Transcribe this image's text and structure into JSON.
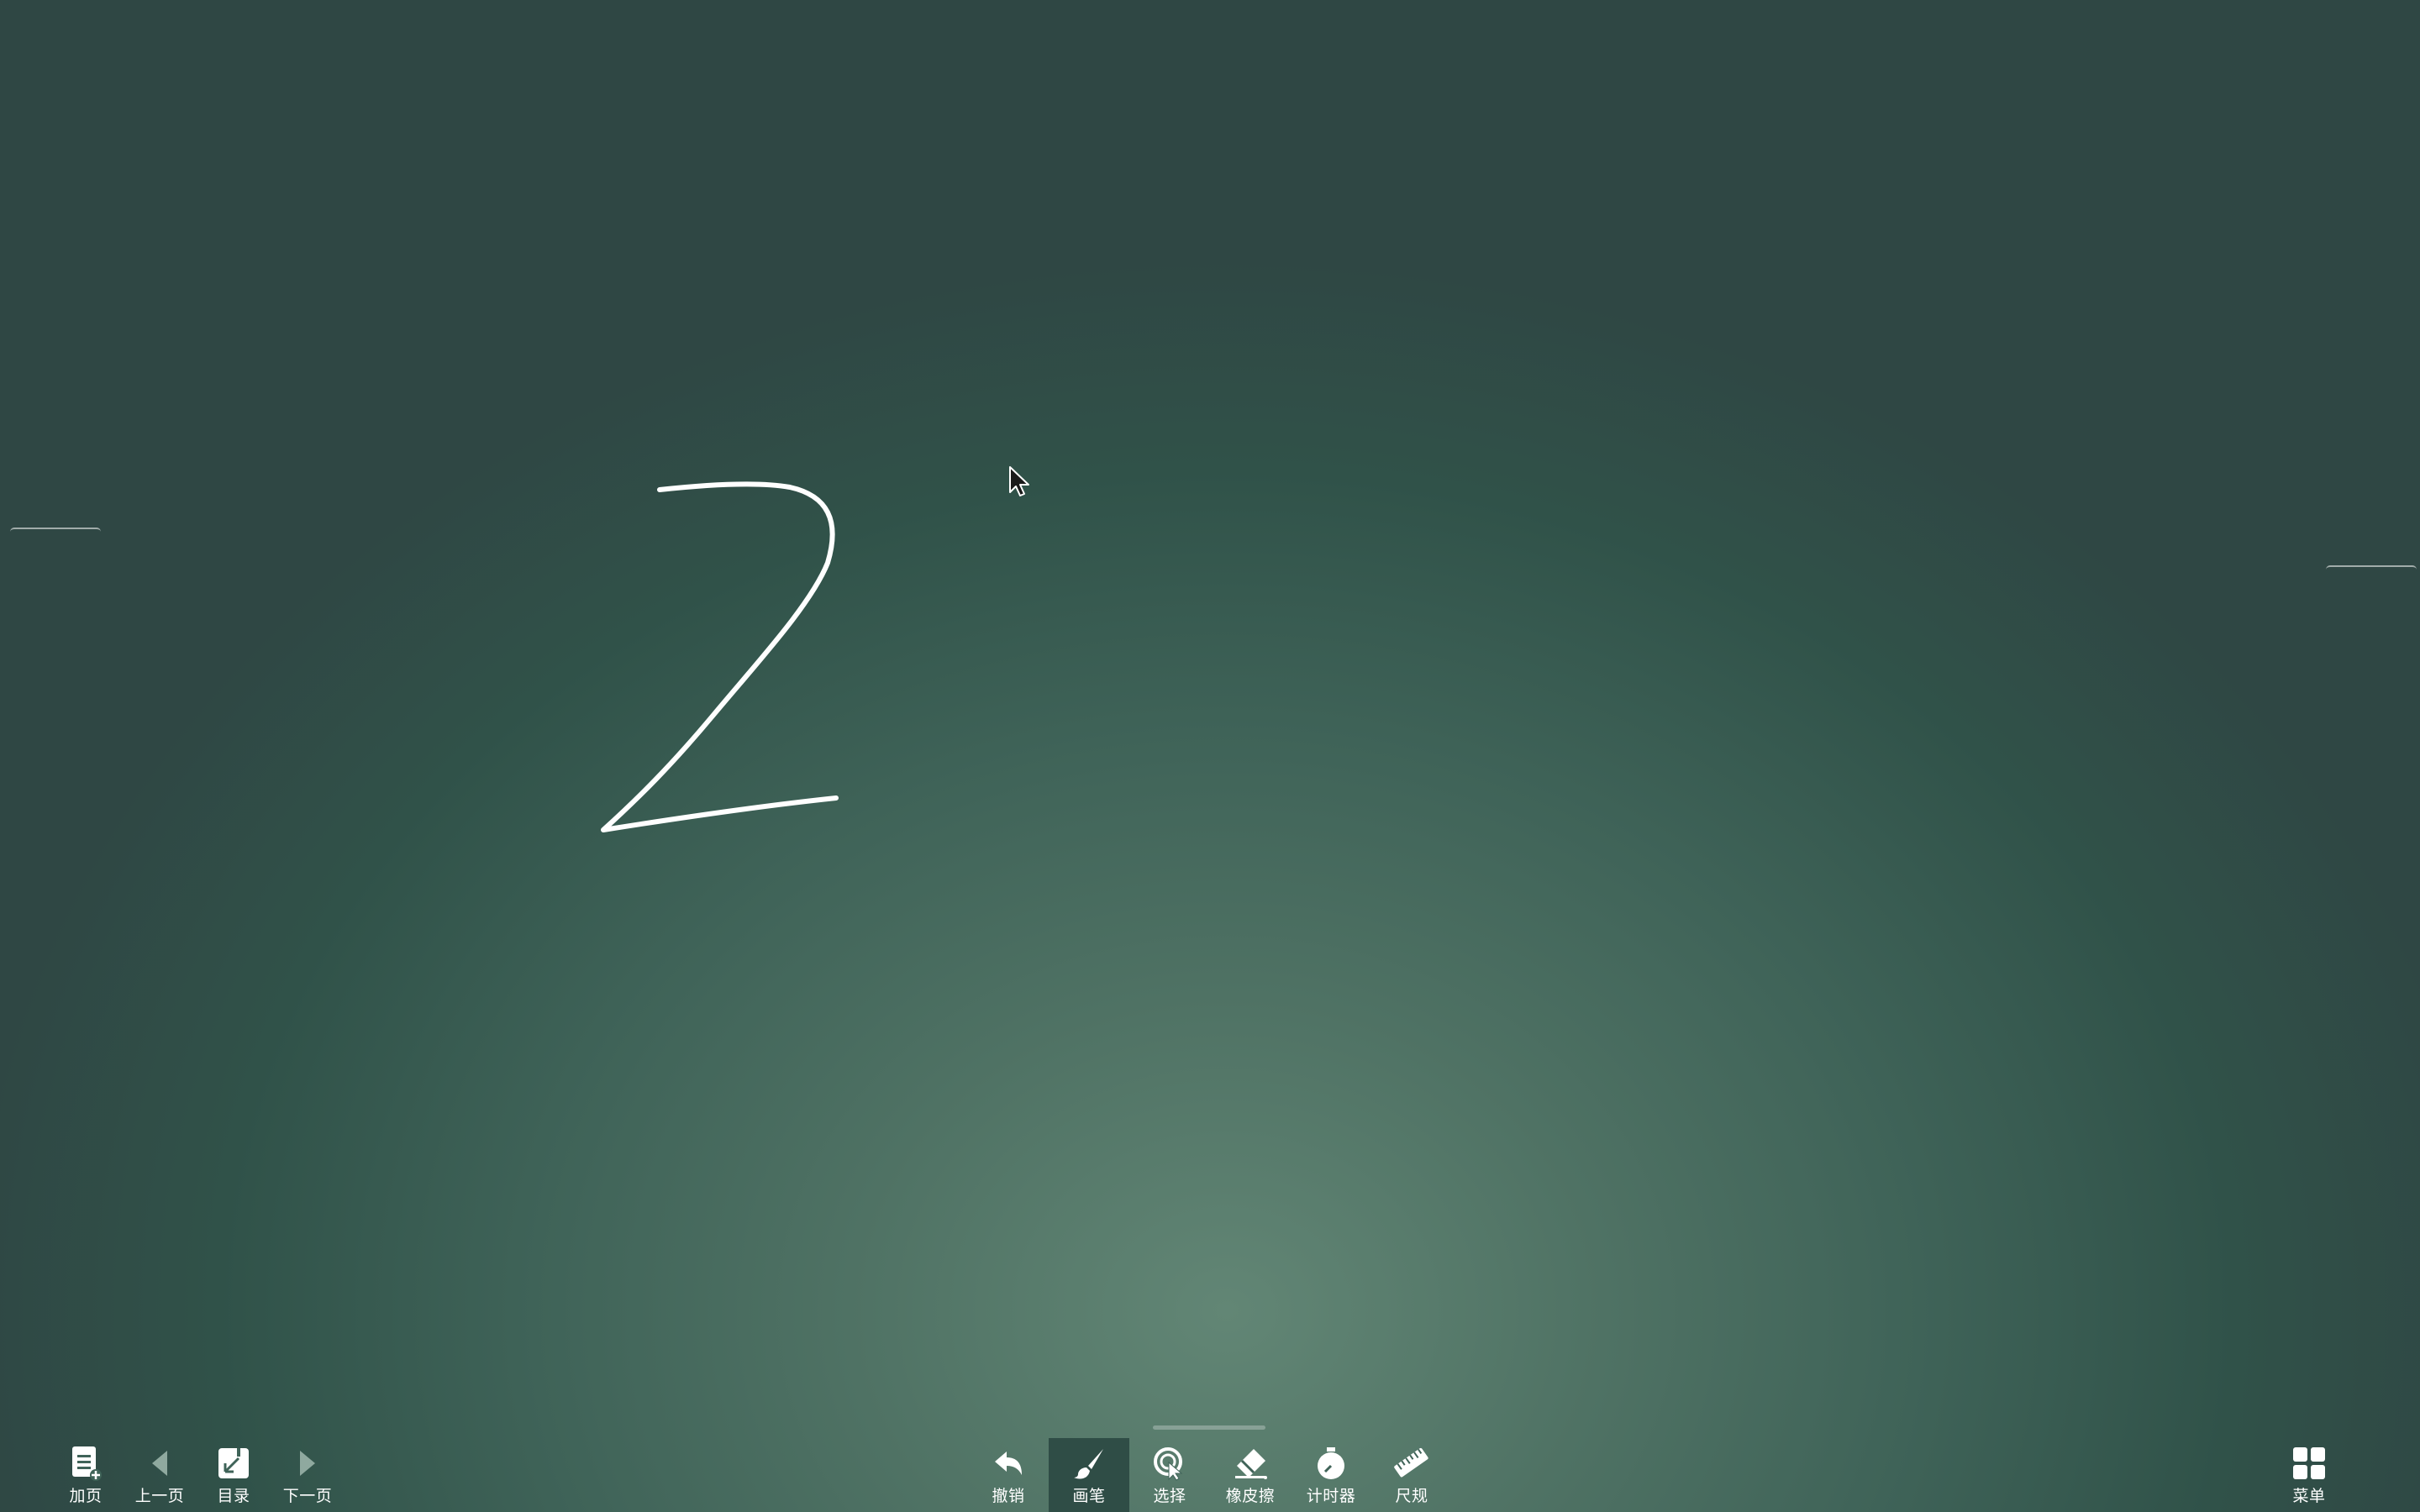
{
  "app": {
    "name": "whiteboard"
  },
  "colors": {
    "board_center": "#628675",
    "board_edge": "#2f4744",
    "ink": "#ffffff",
    "active_tool_bg": "#2f4d46"
  },
  "canvas": {
    "handwritten_text": "2"
  },
  "left_toolbar": {
    "items": [
      {
        "label": "加页",
        "icon": "add-page-icon"
      },
      {
        "label": "上一页",
        "icon": "arrow-left-icon"
      },
      {
        "label": "目录",
        "icon": "catalog-icon"
      },
      {
        "label": "下一页",
        "icon": "arrow-right-icon"
      }
    ]
  },
  "center_toolbar": {
    "active": "画笔",
    "items": [
      {
        "label": "撤销",
        "icon": "undo-icon"
      },
      {
        "label": "画笔",
        "icon": "brush-icon"
      },
      {
        "label": "选择",
        "icon": "select-icon"
      },
      {
        "label": "橡皮擦",
        "icon": "eraser-icon"
      },
      {
        "label": "计时器",
        "icon": "timer-icon"
      },
      {
        "label": "尺规",
        "icon": "ruler-icon"
      }
    ]
  },
  "right_toolbar": {
    "items": [
      {
        "label": "菜单",
        "icon": "menu-grid-icon"
      }
    ]
  }
}
